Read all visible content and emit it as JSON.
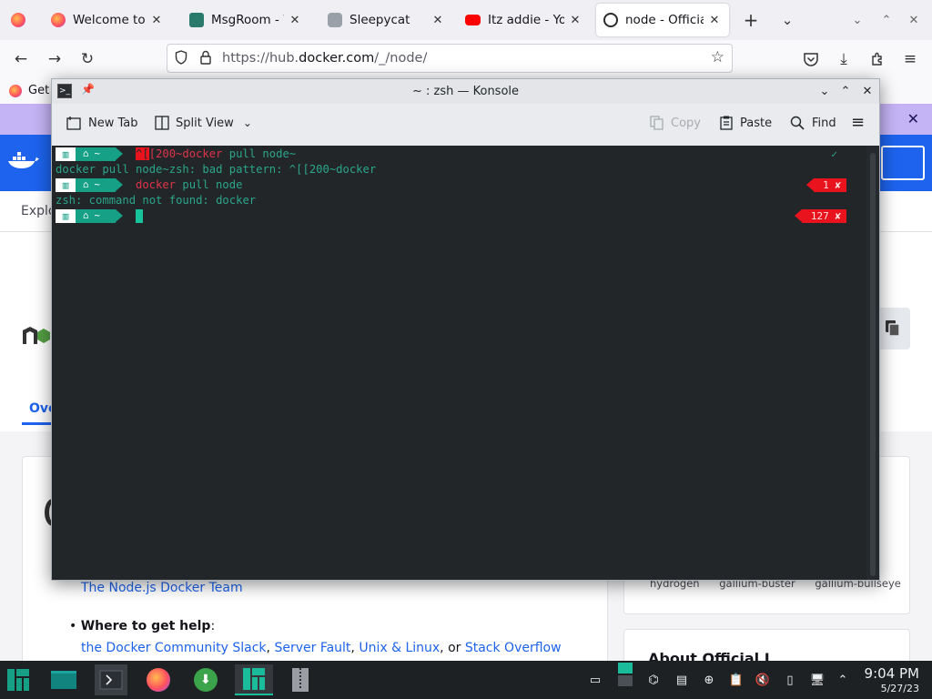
{
  "browser": {
    "tabs": [
      {
        "title": "Welcome to Fir",
        "active": false
      },
      {
        "title": "MsgRoom - Wi",
        "active": false
      },
      {
        "title": "Sleepycat",
        "active": false
      },
      {
        "title": "Itz addie - YouT",
        "active": false
      },
      {
        "title": "node - Official I",
        "active": true
      }
    ],
    "url_prefix": "https://hub.",
    "url_domain": "docker.com",
    "url_path": "/_/node/",
    "bookmark": "Get"
  },
  "page": {
    "explore": "Explo",
    "overview_tab": "Ove",
    "maintainer_link": "The Node.js Docker Team",
    "help_label": "Where to get help",
    "help_colon": ":",
    "help_links": [
      "the Docker Community Slack",
      "Server Fault",
      "Unix & Linux",
      "Stack Overflow"
    ],
    "help_sep": ", ",
    "help_or": ", or ",
    "tags": "hydrogen gallium-buster gallium-bullseye",
    "about_heading": "About Official I"
  },
  "konsole": {
    "title": "~ : zsh — Konsole",
    "toolbar": {
      "new_tab": "New Tab",
      "split_view": "Split View",
      "copy": "Copy",
      "paste": "Paste",
      "find": "Find"
    },
    "prompt_home": "~",
    "lines": {
      "l1_esc": "^[",
      "l1_cmd_red": "[200~docker",
      "l1_rest": " pull node~",
      "l1_check": "✓",
      "l2": "docker pull node~zsh: bad pattern: ^[[200~docker",
      "l3_cmd": "docker",
      "l3_rest": " pull node",
      "l3_status": "1 ✘",
      "l4": "zsh: command not found: docker",
      "l5_status": "127 ✘"
    }
  },
  "taskbar": {
    "time": "9:04 PM",
    "date": "5/27/23"
  },
  "colors": {
    "terminal_bg": "#232629",
    "prompt_teal": "#16a085",
    "error_red": "#e8131d",
    "docker_blue": "#1d63ed"
  }
}
